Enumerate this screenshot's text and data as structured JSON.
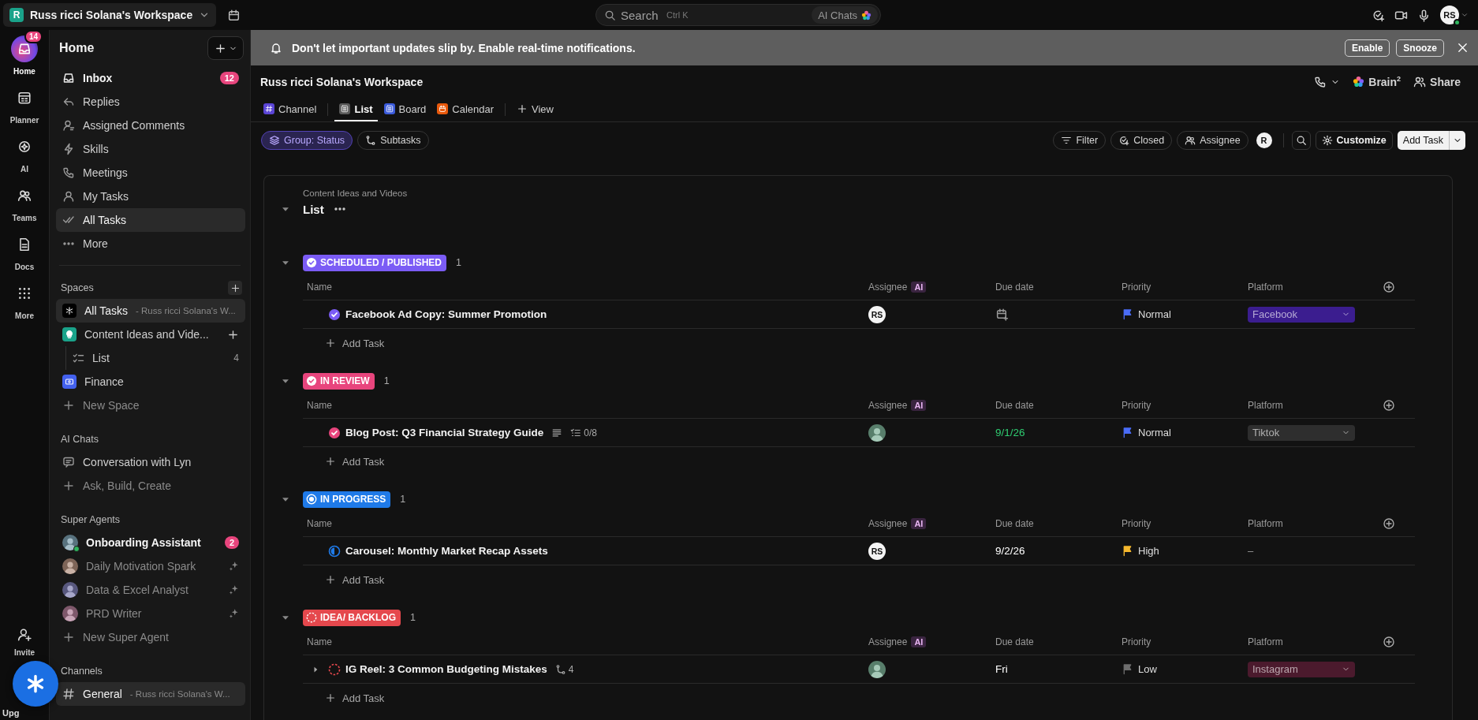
{
  "top_bar": {
    "workspace": {
      "initial": "R",
      "name": "Russ ricci Solana's Workspace"
    },
    "search": {
      "placeholder": "Search",
      "shortcut": "Ctrl K"
    },
    "ai_chats": "AI Chats",
    "user": {
      "initials": "RS",
      "online": true
    }
  },
  "rail": {
    "items": [
      {
        "label": "Home",
        "selected": true,
        "badge": "14"
      },
      {
        "label": "Planner",
        "selected": false
      },
      {
        "label": "AI",
        "selected": false
      },
      {
        "label": "Teams",
        "selected": false
      },
      {
        "label": "Docs",
        "selected": false
      },
      {
        "label": "More",
        "selected": false
      }
    ],
    "bottom": [
      {
        "label": "Invite"
      },
      {
        "label": "Upg"
      }
    ]
  },
  "sidebar": {
    "title": "Home",
    "nav": [
      {
        "label": "Inbox",
        "selected": false,
        "unread": true,
        "badge": "12"
      },
      {
        "label": "Replies",
        "selected": false,
        "unread": false
      },
      {
        "label": "Assigned Comments",
        "selected": false,
        "unread": false
      },
      {
        "label": "Skills",
        "selected": false,
        "unread": false
      },
      {
        "label": "Meetings",
        "selected": false,
        "unread": false
      },
      {
        "label": "My Tasks",
        "selected": false,
        "unread": false
      },
      {
        "label": "All Tasks",
        "selected": true,
        "unread": false
      },
      {
        "label": "More",
        "selected": false,
        "unread": false
      }
    ],
    "sections": [
      {
        "title": "Spaces",
        "items": [
          {
            "kind": "space",
            "label": "All Tasks",
            "detail": "- Russ ricci Solana's W...",
            "color": "#000000",
            "selected": true
          },
          {
            "kind": "space",
            "label": "Content Ideas and Vide...",
            "color": "#1aa38a",
            "selected": false,
            "children": [
              {
                "kind": "list",
                "label": "List",
                "count": "4"
              }
            ]
          },
          {
            "kind": "space",
            "label": "Finance",
            "color": "#4361ee",
            "selected": false
          },
          {
            "kind": "add",
            "label": "New Space"
          }
        ]
      },
      {
        "title": "AI Chats",
        "items": [
          {
            "kind": "chat",
            "label": "Conversation with Lyn",
            "selected": false
          },
          {
            "kind": "add",
            "label": "Ask, Build, Create"
          }
        ]
      },
      {
        "title": "Super Agents",
        "items": [
          {
            "kind": "agent",
            "label": "Onboarding Assistant",
            "active": true,
            "badge": "2"
          },
          {
            "kind": "agent",
            "label": "Daily Motivation Spark",
            "active": false
          },
          {
            "kind": "agent",
            "label": "Data & Excel Analyst",
            "active": false
          },
          {
            "kind": "agent",
            "label": "PRD Writer",
            "active": false
          },
          {
            "kind": "add",
            "label": "New Super Agent"
          }
        ]
      },
      {
        "title": "Channels",
        "items": [
          {
            "kind": "channel",
            "label": "General",
            "detail": "- Russ ricci Solana's W...",
            "selected": true
          }
        ]
      }
    ]
  },
  "banner": {
    "text": "Don't let important updates slip by. Enable real-time notifications.",
    "buttons": [
      "Enable",
      "Snooze"
    ]
  },
  "header": {
    "title": "Russ ricci Solana's Workspace",
    "brain": "Brain$^{2}$",
    "share": "Share",
    "tabs": [
      {
        "label": "Channel",
        "selected": false,
        "color": "#5b45d6"
      },
      {
        "label": "List",
        "selected": true,
        "color": "#5a5a5a"
      },
      {
        "label": "Board",
        "selected": false,
        "color": "#3b5bdb"
      },
      {
        "label": "Calendar",
        "selected": false,
        "color": "#e8590c"
      }
    ],
    "add_view": "View"
  },
  "toolbar": {
    "left": [
      {
        "label": "Group: Status",
        "selected": true
      },
      {
        "label": "Subtasks",
        "selected": false
      }
    ],
    "filters": [
      "Filter",
      "Closed",
      "Assignee"
    ],
    "assignee_avatar": "R",
    "customize": "Customize",
    "add_task": "Add Task"
  },
  "list": {
    "breadcrumb": "Content Ideas and Videos",
    "title": "List",
    "groups": [
      {
        "status": "SCHEDULED / PUBLISHED",
        "kind": "done",
        "color": "#7b5cf5",
        "count": "1",
        "columns": [
          "Name",
          "Assignee",
          "Due date",
          "Priority",
          "Platform"
        ],
        "ai_badge": "AI",
        "tasks": [
          {
            "name": "Facebook Ad Copy: Summer Promotion",
            "assignee": {
              "kind": "initials",
              "text": "RS"
            },
            "due": {
              "kind": "empty"
            },
            "priority": {
              "label": "Normal",
              "color": "#4a6cf7"
            },
            "platform": {
              "kind": "tag",
              "label": "Facebook",
              "color": "#3b1d8f"
            }
          }
        ],
        "add_label": "Add Task"
      },
      {
        "status": "IN REVIEW",
        "kind": "done",
        "color": "#e8457d",
        "count": "1",
        "columns": [
          "Name",
          "Assignee",
          "Due date",
          "Priority",
          "Platform"
        ],
        "ai_badge": "AI",
        "tasks": [
          {
            "name": "Blog Post: Q3 Financial Strategy Guide",
            "extras": [
              {
                "kind": "description"
              },
              {
                "kind": "checklist",
                "text": "0/8"
              }
            ],
            "assignee": {
              "kind": "picture"
            },
            "due": {
              "kind": "date",
              "text": "9/1/26",
              "color": "#2fcc71"
            },
            "priority": {
              "label": "Normal",
              "color": "#4a6cf7"
            },
            "platform": {
              "kind": "tag",
              "label": "Tiktok",
              "color": "#2e2e2e"
            }
          }
        ],
        "add_label": "Add Task"
      },
      {
        "status": "IN PROGRESS",
        "kind": "progress",
        "color": "#1f7ae8",
        "count": "1",
        "columns": [
          "Name",
          "Assignee",
          "Due date",
          "Priority",
          "Platform"
        ],
        "ai_badge": "AI",
        "tasks": [
          {
            "name": "Carousel: Monthly Market Recap Assets",
            "assignee": {
              "kind": "initials",
              "text": "RS"
            },
            "due": {
              "kind": "date",
              "text": "9/2/26",
              "color": "#ffffff"
            },
            "priority": {
              "label": "High",
              "color": "#f5b82e"
            },
            "platform": {
              "kind": "none",
              "label": "–"
            }
          }
        ],
        "add_label": "Add Task"
      },
      {
        "status": "IDEA/ BACKLOG",
        "kind": "backlog",
        "color": "#e5484d",
        "count": "1",
        "columns": [
          "Name",
          "Assignee",
          "Due date",
          "Priority",
          "Platform"
        ],
        "ai_badge": "AI",
        "tasks": [
          {
            "name": "IG Reel: 3 Common Budgeting Mistakes",
            "expandable": true,
            "extras": [
              {
                "kind": "subtasks",
                "text": "4"
              }
            ],
            "assignee": {
              "kind": "picture"
            },
            "due": {
              "kind": "date",
              "text": "Fri",
              "color": "#ffffff"
            },
            "priority": {
              "label": "Low",
              "color": "#6e6e6e"
            },
            "platform": {
              "kind": "tag",
              "label": "Instagram",
              "color": "#4b1a2d"
            }
          }
        ],
        "add_label": "Add Task"
      }
    ]
  }
}
